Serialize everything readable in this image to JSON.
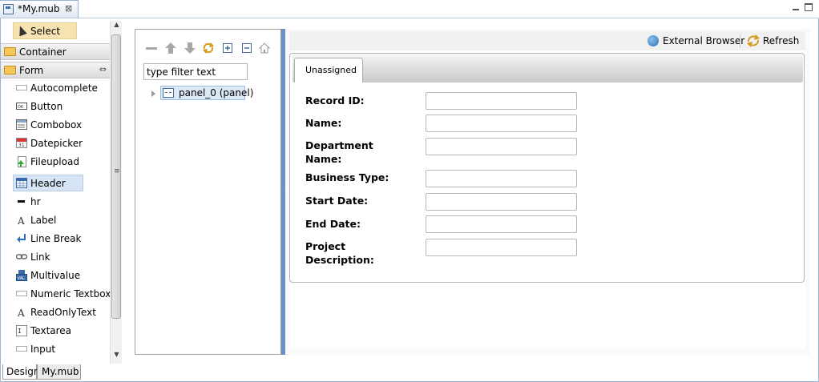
{
  "editor": {
    "tab_title": "*My.mub",
    "close_glyph": "⊠"
  },
  "palette": {
    "select_label": "Select",
    "drawers": {
      "container": "Container",
      "form": "Form",
      "form_collapse_glyph": "⇔"
    },
    "items": [
      {
        "label": "Autocomplete",
        "icon": "textbox-icon"
      },
      {
        "label": "Button",
        "icon": "button-icon"
      },
      {
        "label": "Combobox",
        "icon": "combobox-icon"
      },
      {
        "label": "Datepicker",
        "icon": "calendar-icon"
      },
      {
        "label": "Fileupload",
        "icon": "upload-icon"
      },
      {
        "label": "Header",
        "icon": "header-table-icon"
      },
      {
        "label": "hr",
        "icon": "hr-line-icon"
      },
      {
        "label": "Label",
        "icon": "label-a-icon"
      },
      {
        "label": "Line Break",
        "icon": "line-break-icon"
      },
      {
        "label": "Link",
        "icon": "chain-link-icon"
      },
      {
        "label": "Multivalue",
        "icon": "multivalue-icon"
      },
      {
        "label": "Numeric Textbox",
        "icon": "textbox-icon"
      },
      {
        "label": "ReadOnlyText",
        "icon": "label-a-icon"
      },
      {
        "label": "Textarea",
        "icon": "textarea-icon"
      },
      {
        "label": "Input",
        "icon": "textbox-icon"
      }
    ]
  },
  "bottom_tabs": {
    "design": "Design",
    "source": "My.mub"
  },
  "outline": {
    "filter_placeholder": "type filter text",
    "filter_value": "type filter text",
    "tree_node_label": "panel_0 (panel)"
  },
  "preview": {
    "external_browser_label": "External Browser",
    "refresh_label": "Refresh",
    "tab_label": "Unassigned",
    "fields": [
      {
        "label": "Record ID:",
        "value": ""
      },
      {
        "label": "Name:",
        "value": ""
      },
      {
        "label": "Department Name:",
        "value": ""
      },
      {
        "label": "Business Type:",
        "value": ""
      },
      {
        "label": "Start Date:",
        "value": ""
      },
      {
        "label": "End Date:",
        "value": ""
      },
      {
        "label": "Project Description:",
        "value": ""
      }
    ]
  },
  "colors": {
    "sash": "#6b8fc7",
    "selection": "#f7e3b2",
    "tree_selection": "#dbe8f6"
  }
}
